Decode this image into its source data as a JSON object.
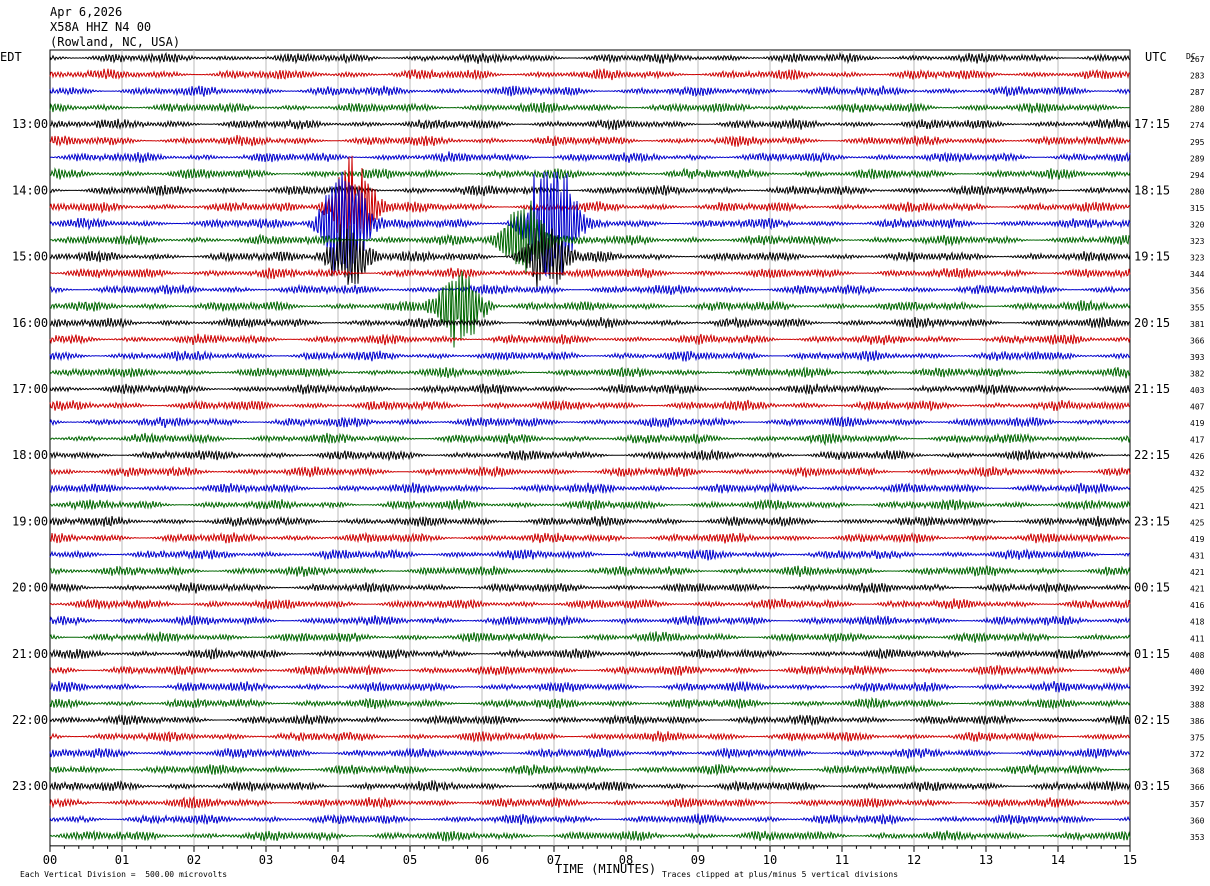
{
  "header": {
    "date": "Apr 6,2026",
    "station": "X58A HHZ N4 00",
    "location": "(Rowland, NC, USA)"
  },
  "left_zone_label": "EDT",
  "right_zone_label": "UTC",
  "dc_label": "DC",
  "chart_data": {
    "type": "line",
    "title": "X58A HHZ N4 00",
    "xlabel": "TIME (MINUTES)",
    "x_ticks": [
      "00",
      "01",
      "02",
      "03",
      "04",
      "05",
      "06",
      "07",
      "08",
      "09",
      "10",
      "11",
      "12",
      "13",
      "14",
      "15"
    ],
    "xlim": [
      0,
      15
    ],
    "trace_colors": [
      "#000000",
      "#cc0000",
      "#0000cc",
      "#006600"
    ],
    "traces_per_hour": 4,
    "trace_count": 48,
    "left_hour_labels": [
      {
        "row": 4,
        "label": "13:00"
      },
      {
        "row": 8,
        "label": "14:00"
      },
      {
        "row": 12,
        "label": "15:00"
      },
      {
        "row": 16,
        "label": "16:00"
      },
      {
        "row": 20,
        "label": "17:00"
      },
      {
        "row": 24,
        "label": "18:00"
      },
      {
        "row": 28,
        "label": "19:00"
      },
      {
        "row": 32,
        "label": "20:00"
      },
      {
        "row": 36,
        "label": "21:00"
      },
      {
        "row": 40,
        "label": "22:00"
      },
      {
        "row": 44,
        "label": "23:00"
      }
    ],
    "right_hour_labels": [
      {
        "row": 4,
        "label": "17:15"
      },
      {
        "row": 8,
        "label": "18:15"
      },
      {
        "row": 12,
        "label": "19:15"
      },
      {
        "row": 16,
        "label": "20:15"
      },
      {
        "row": 20,
        "label": "21:15"
      },
      {
        "row": 24,
        "label": "22:15"
      },
      {
        "row": 28,
        "label": "23:15"
      },
      {
        "row": 32,
        "label": "00:15"
      },
      {
        "row": 36,
        "label": "01:15"
      },
      {
        "row": 40,
        "label": "02:15"
      },
      {
        "row": 44,
        "label": "03:15"
      }
    ],
    "dc_offsets": [
      "267",
      "283",
      "287",
      "280",
      "274",
      "295",
      "289",
      "294",
      "280",
      "315",
      "320",
      "323",
      "323",
      "344",
      "356",
      "355",
      "381",
      "366",
      "393",
      "382",
      "403",
      "407",
      "419",
      "417",
      "426",
      "432",
      "425",
      "421",
      "425",
      "419",
      "431",
      "421",
      "421",
      "416",
      "418",
      "411",
      "408",
      "400",
      "392",
      "388",
      "386",
      "375",
      "372",
      "368",
      "366",
      "357",
      "360",
      "353"
    ],
    "events": [
      {
        "row": 9,
        "minute": 4.2,
        "amplitude": 3.0
      },
      {
        "row": 10,
        "minute": 4.1,
        "amplitude": 4.0
      },
      {
        "row": 10,
        "minute": 6.95,
        "amplitude": 5.0
      },
      {
        "row": 11,
        "minute": 6.6,
        "amplitude": 2.5
      },
      {
        "row": 12,
        "minute": 4.15,
        "amplitude": 2.0
      },
      {
        "row": 12,
        "minute": 6.9,
        "amplitude": 2.0
      },
      {
        "row": 15,
        "minute": 5.7,
        "amplitude": 2.5
      }
    ]
  },
  "footer": {
    "scale_note": "Each Vertical Division =  500.00 microvolts",
    "clip_note": "Traces clipped at plus/minus 5 vertical divisions"
  }
}
